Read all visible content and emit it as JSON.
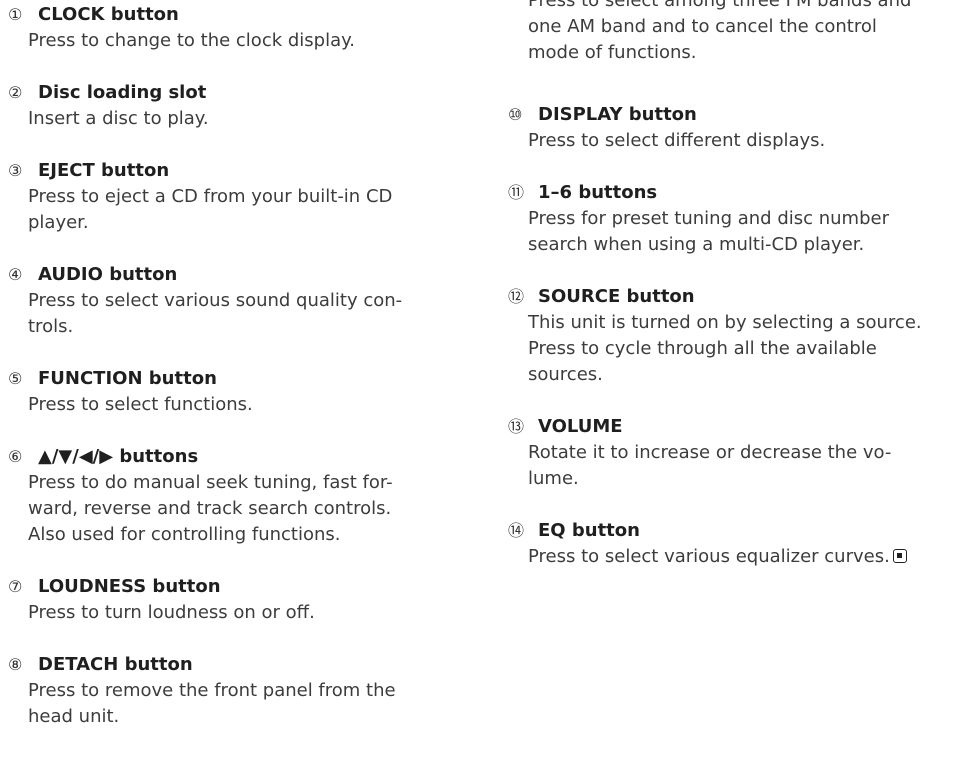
{
  "left_items": [
    {
      "num": "①",
      "title": "CLOCK button",
      "lines": [
        "Press to change to the clock display."
      ]
    },
    {
      "num": "②",
      "title": "Disc loading slot",
      "lines": [
        "Insert a disc to play."
      ]
    },
    {
      "num": "③",
      "title": "EJECT button",
      "lines": [
        "Press to eject a CD from your built-in CD",
        "player."
      ]
    },
    {
      "num": "④",
      "title": "AUDIO button",
      "lines": [
        "Press to select various sound quality con-",
        "trols."
      ]
    },
    {
      "num": "⑤",
      "title": "FUNCTION button",
      "lines": [
        "Press to select functions."
      ]
    },
    {
      "num": "⑥",
      "title": "▲/▼/◀/▶ buttons",
      "lines": [
        "Press to do manual seek tuning, fast for-",
        "ward, reverse and track search controls.",
        "Also used for controlling functions."
      ]
    },
    {
      "num": "⑦",
      "title": "LOUDNESS button",
      "lines": [
        "Press to turn loudness on or off."
      ]
    },
    {
      "num": "⑧",
      "title": "DETACH button",
      "lines": [
        "Press to remove the front panel from the",
        "head unit."
      ]
    }
  ],
  "right_continuation": {
    "lines": [
      "Press to select among three FM bands and",
      "one AM band and to cancel the control",
      "mode of functions."
    ]
  },
  "right_items": [
    {
      "num": "⑩",
      "title": "DISPLAY button",
      "lines": [
        "Press to select different displays."
      ]
    },
    {
      "num": "⑪",
      "title": "1–6 buttons",
      "lines": [
        "Press for preset tuning and disc number",
        "search when using a multi-CD player."
      ]
    },
    {
      "num": "⑫",
      "title": "SOURCE button",
      "lines": [
        "This unit is turned on by selecting a source.",
        "Press to cycle through all the available",
        "sources."
      ]
    },
    {
      "num": "⑬",
      "title": "VOLUME",
      "lines": [
        "Rotate it to increase or decrease the vo-",
        "lume."
      ]
    },
    {
      "num": "⑭",
      "title": "EQ button",
      "lines": [
        "Press to select various equalizer curves."
      ]
    }
  ]
}
